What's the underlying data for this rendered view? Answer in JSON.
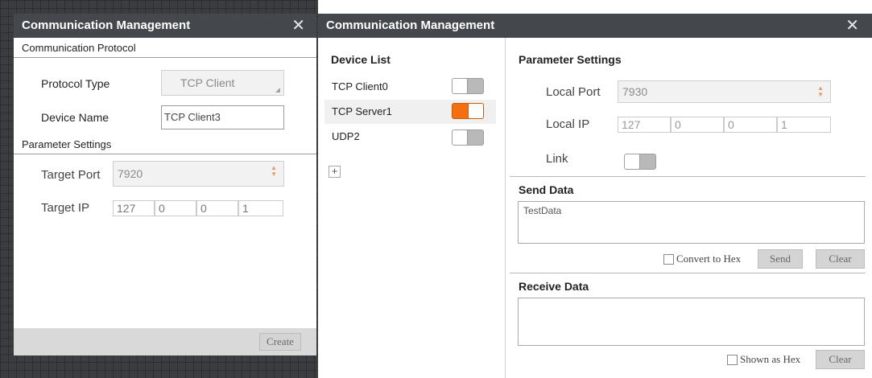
{
  "left_dialog": {
    "title": "Communication Management",
    "close_glyph": "✕",
    "section_protocol": "Communication Protocol",
    "protocol_type_label": "Protocol Type",
    "protocol_type_value": "TCP Client",
    "device_name_label": "Device Name",
    "device_name_value": "TCP Client3",
    "section_params": "Parameter Settings",
    "target_port_label": "Target Port",
    "target_port_value": "7920",
    "target_ip_label": "Target IP",
    "target_ip": [
      "127",
      "0",
      "0",
      "1"
    ],
    "create_label": "Create"
  },
  "right_dialog": {
    "title": "Communication Management",
    "close_glyph": "✕",
    "device_list_header": "Device List",
    "devices": [
      {
        "name": "TCP Client0",
        "enabled": false
      },
      {
        "name": "TCP Server1",
        "enabled": true
      },
      {
        "name": "UDP2",
        "enabled": false
      }
    ],
    "add_glyph": "+",
    "param_header": "Parameter Settings",
    "local_port_label": "Local Port",
    "local_port_value": "7930",
    "local_ip_label": "Local IP",
    "local_ip": [
      "127",
      "0",
      "0",
      "1"
    ],
    "link_label": "Link",
    "link_enabled": false,
    "send_header": "Send Data",
    "send_text": "TestData",
    "convert_hex_label": "Convert to Hex",
    "send_label": "Send",
    "clear_send_label": "Clear",
    "receive_header": "Receive Data",
    "receive_text": "",
    "shown_hex_label": "Shown as Hex",
    "clear_receive_label": "Clear"
  },
  "colors": {
    "titlebar": "#44484d",
    "accent_toggle_on": "#f36f0f",
    "spinner_arrows": "#e59a66"
  }
}
